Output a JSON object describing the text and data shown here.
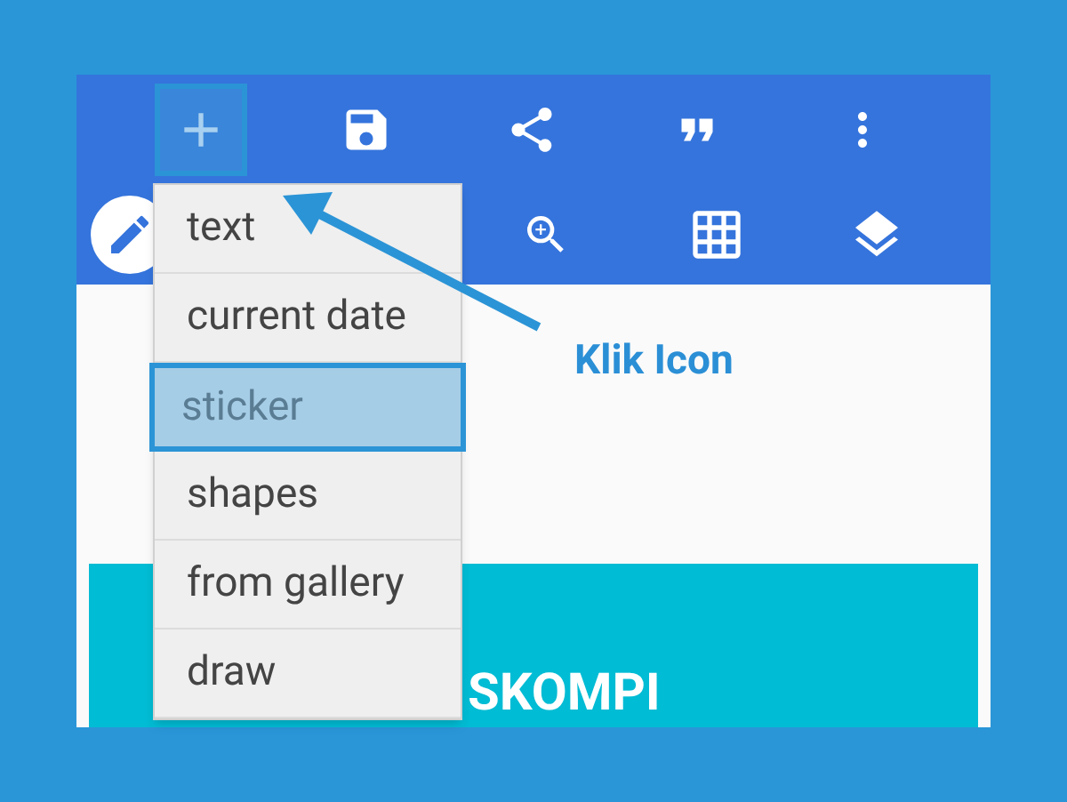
{
  "toolbar": {
    "add_button": {
      "highlighted": true
    }
  },
  "add_menu": [
    {
      "label": "text",
      "selected": false
    },
    {
      "label": "current date",
      "selected": false
    },
    {
      "label": "sticker",
      "selected": true
    },
    {
      "label": "shapes",
      "selected": false
    },
    {
      "label": "from gallery",
      "selected": false
    },
    {
      "label": "draw",
      "selected": false
    }
  ],
  "banner": {
    "text": "SKOMPI"
  },
  "annotation": {
    "label": "Klik Icon"
  }
}
